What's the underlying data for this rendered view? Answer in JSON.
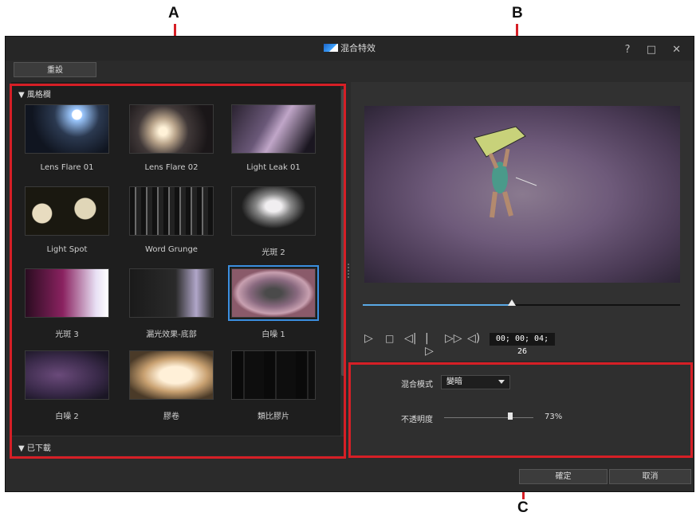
{
  "callouts": {
    "a": "A",
    "b": "B",
    "c": "C"
  },
  "window": {
    "title": "混合特效",
    "controls": "? □ ✕",
    "reset_label": "重設",
    "ok_label": "確定",
    "cancel_label": "取消"
  },
  "library": {
    "category_header": "▼ 風格欄",
    "downloaded_header": "▼ 已下載",
    "items": [
      {
        "label": "Lens Flare 01",
        "icon": "lens-flare-thumb"
      },
      {
        "label": "Lens Flare 02",
        "icon": "lens-flare-thumb"
      },
      {
        "label": "Light Leak 01",
        "icon": "light-leak-thumb"
      },
      {
        "label": "Light Spot",
        "icon": "light-spot-thumb"
      },
      {
        "label": "Word Grunge",
        "icon": "grunge-thumb"
      },
      {
        "label": "光斑 2",
        "icon": "flare-thumb"
      },
      {
        "label": "光斑 3",
        "icon": "flare-thumb"
      },
      {
        "label": "漏光效果-底部",
        "icon": "light-leak-thumb"
      },
      {
        "label": "白噪 1",
        "icon": "noise-thumb",
        "selected": true
      },
      {
        "label": "白噪 2",
        "icon": "noise-thumb"
      },
      {
        "label": "膠卷",
        "icon": "film-thumb"
      },
      {
        "label": "類比膠片",
        "icon": "analog-film-thumb"
      }
    ]
  },
  "preview": {
    "timecode": "00; 00; 04; 26",
    "progress": 0.47
  },
  "settings": {
    "blend_mode_label": "混合模式",
    "blend_mode_value": "變暗",
    "opacity_label": "不透明度",
    "opacity_value": "73%",
    "opacity_fraction": 0.73
  },
  "colors": {
    "highlight": "#d61f26",
    "accent": "#5aa9e6",
    "selection": "#3b8fe0"
  }
}
